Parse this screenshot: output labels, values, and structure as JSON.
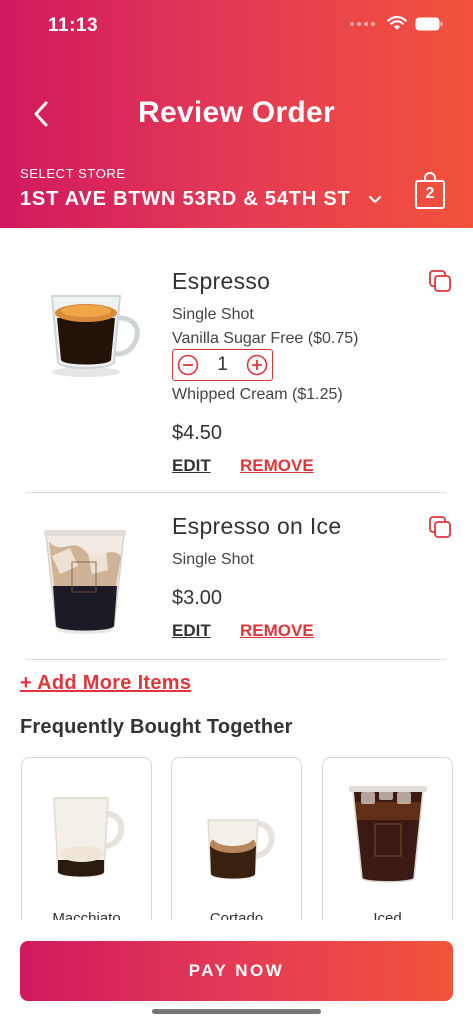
{
  "status_bar": {
    "time": "11:13"
  },
  "header": {
    "title": "Review Order",
    "store_label": "SELECT STORE",
    "store_name": "1ST AVE BTWN 53RD & 54TH ST",
    "cart_count": "2"
  },
  "items": [
    {
      "name": "Espresso",
      "options": [
        "Single Shot",
        "Vanilla Sugar Free ($0.75)",
        "Whipped Cream ($1.25)"
      ],
      "quantity": "1",
      "price": "$4.50",
      "edit_label": "EDIT",
      "remove_label": "REMOVE"
    },
    {
      "name": "Espresso on Ice",
      "options": [
        "Single Shot"
      ],
      "price": "$3.00",
      "edit_label": "EDIT",
      "remove_label": "REMOVE"
    }
  ],
  "add_more_label": "+ Add More Items",
  "frequently_bought": {
    "title": "Frequently Bought Together",
    "products": [
      {
        "name": "Macchiato"
      },
      {
        "name": "Cortado"
      },
      {
        "name": "Iced"
      }
    ]
  },
  "pay_button_label": "PAY NOW",
  "colors": {
    "gradient_start": "#d0195e",
    "gradient_end": "#f2533a",
    "accent_red": "#e0353b"
  }
}
